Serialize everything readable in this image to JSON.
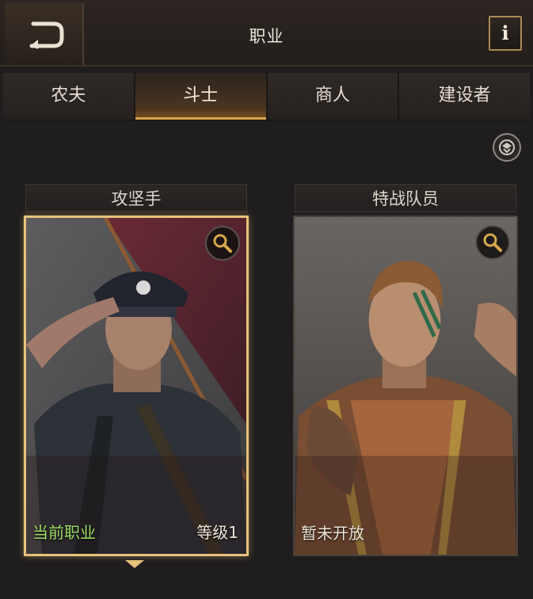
{
  "header": {
    "title": "职业",
    "back_icon": "back-arrow-icon",
    "info_label": "i"
  },
  "tabs": [
    {
      "label": "农夫",
      "active": false
    },
    {
      "label": "斗士",
      "active": true
    },
    {
      "label": "商人",
      "active": false
    },
    {
      "label": "建设者",
      "active": false
    }
  ],
  "filter_icon": "filter-icon",
  "cards": [
    {
      "name": "攻坚手",
      "status": "当前职业",
      "level": "等级1",
      "selected": true,
      "zoom_icon": "magnifier-icon"
    },
    {
      "name": "特战队员",
      "status": "暂未开放",
      "level": "",
      "selected": false,
      "zoom_icon": "magnifier-icon"
    }
  ],
  "colors": {
    "accent": "#e7c27a",
    "current_status": "#9edc62",
    "background": "#1f1d1e"
  }
}
